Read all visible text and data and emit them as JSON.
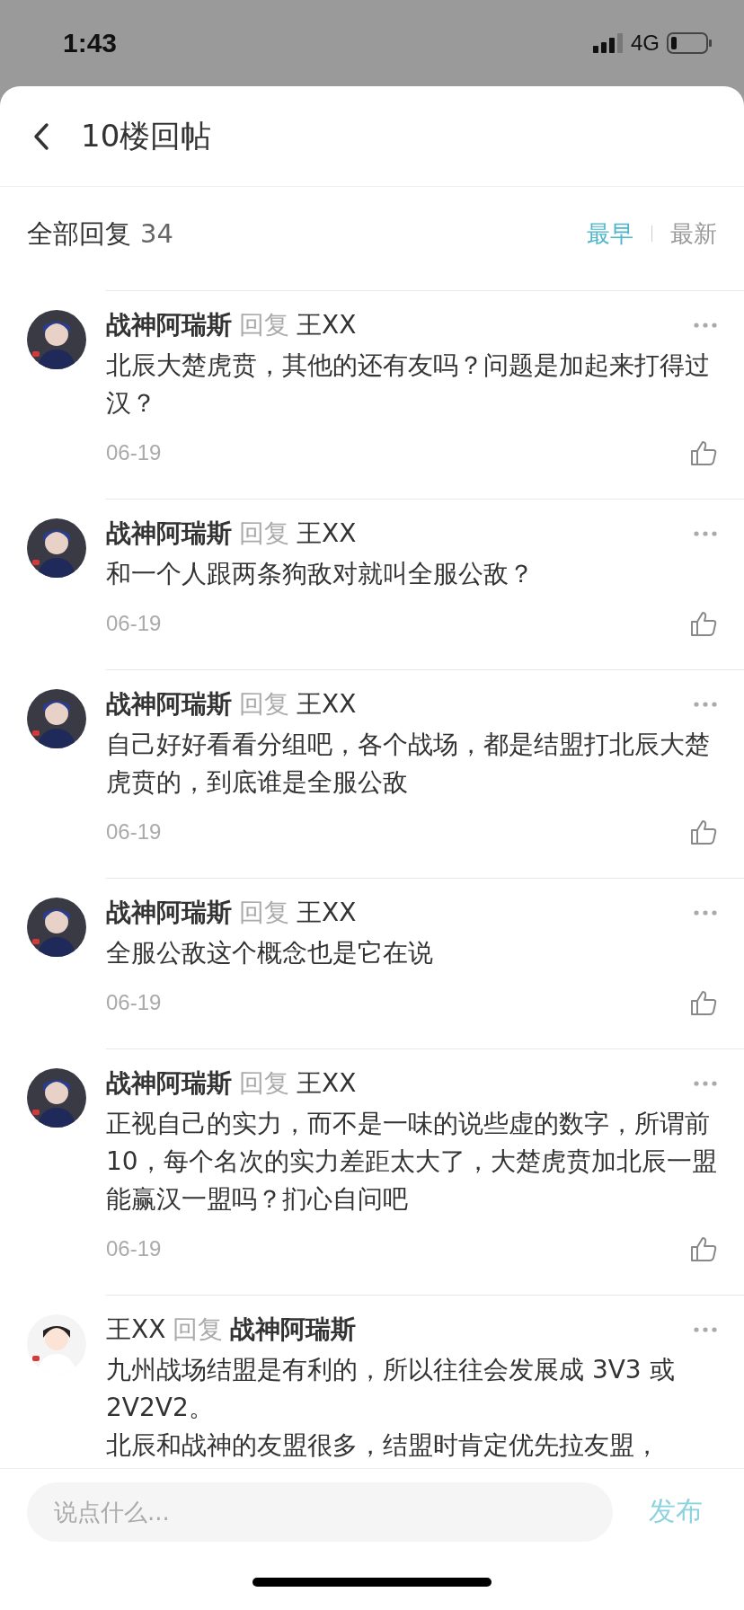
{
  "status_bar": {
    "time": "1:43",
    "network": "4G"
  },
  "header": {
    "title": "10楼回帖"
  },
  "replies_header": {
    "label": "全部回复",
    "count": "34",
    "sort_options": [
      {
        "label": "最早",
        "selected": true
      },
      {
        "label": "最新",
        "selected": false
      }
    ]
  },
  "comments": [
    {
      "author": {
        "name": "战神阿瑞斯",
        "bold": true
      },
      "reply_word": "回复",
      "target": {
        "name": "王XX",
        "bold": false
      },
      "text": "北辰大楚虎贲，其他的还有友吗？问题是加起来打得过汉？",
      "date": "06-19"
    },
    {
      "author": {
        "name": "战神阿瑞斯",
        "bold": true
      },
      "reply_word": "回复",
      "target": {
        "name": "王XX",
        "bold": false
      },
      "text": "和一个人跟两条狗敌对就叫全服公敌？",
      "date": "06-19"
    },
    {
      "author": {
        "name": "战神阿瑞斯",
        "bold": true
      },
      "reply_word": "回复",
      "target": {
        "name": "王XX",
        "bold": false
      },
      "text": "自己好好看看分组吧，各个战场，都是结盟打北辰大楚虎贲的，到底谁是全服公敌",
      "date": "06-19"
    },
    {
      "author": {
        "name": "战神阿瑞斯",
        "bold": true
      },
      "reply_word": "回复",
      "target": {
        "name": "王XX",
        "bold": false
      },
      "text": "全服公敌这个概念也是它在说",
      "date": "06-19"
    },
    {
      "author": {
        "name": "战神阿瑞斯",
        "bold": true
      },
      "reply_word": "回复",
      "target": {
        "name": "王XX",
        "bold": false
      },
      "text": "正视自己的实力，而不是一味的说些虚的数字，所谓前10，每个名次的实力差距太大了，大楚虎贲加北辰一盟能赢汉一盟吗？扪心自问吧",
      "date": "06-19"
    },
    {
      "author": {
        "name": "王XX",
        "bold": false
      },
      "reply_word": "回复",
      "target": {
        "name": "战神阿瑞斯",
        "bold": true
      },
      "text": "九州战场结盟是有利的，所以往往会发展成 3V3 或 2V2V2。",
      "text_2": "北辰和战神的友盟很多，结盟时肯定优先拉友盟，"
    }
  ],
  "composer": {
    "placeholder": "说点什么...",
    "submit": "发布"
  }
}
